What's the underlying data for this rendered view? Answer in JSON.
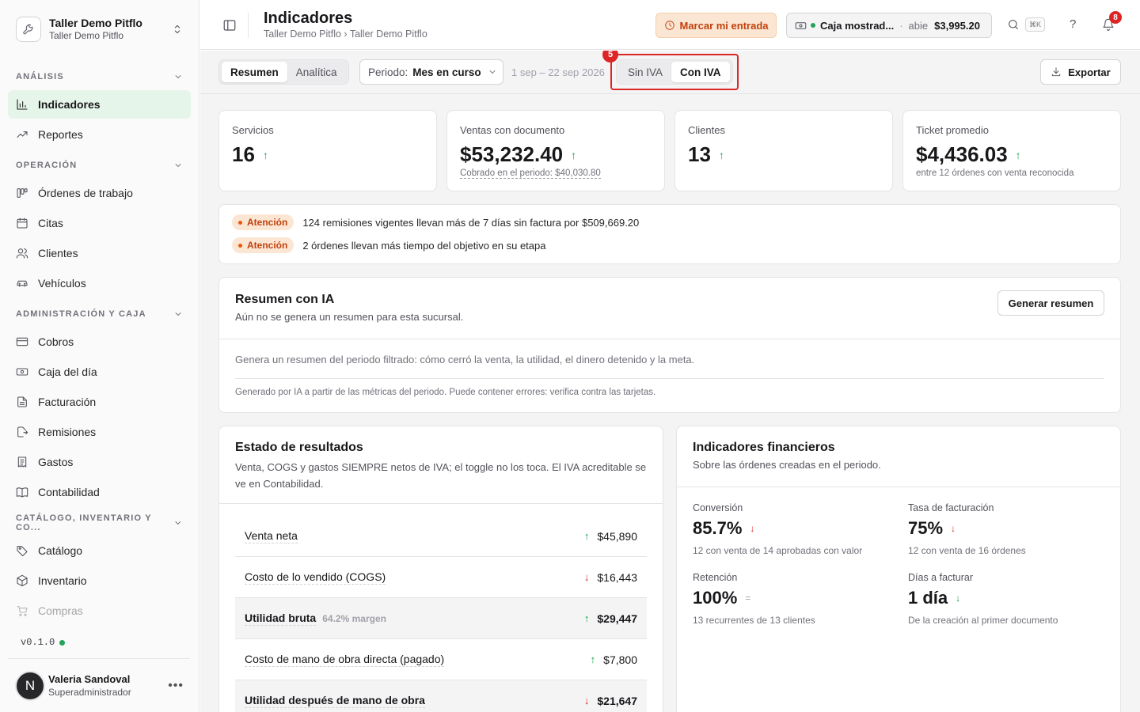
{
  "org": {
    "name": "Taller Demo Pitflo",
    "sub": "Taller Demo Pitflo"
  },
  "sidebar": {
    "sections": [
      {
        "label": "ANÁLISIS",
        "items": [
          {
            "label": "Indicadores",
            "icon": "bar-chart-icon",
            "active": true
          },
          {
            "label": "Reportes",
            "icon": "trend-line-icon"
          }
        ]
      },
      {
        "label": "OPERACIÓN",
        "items": [
          {
            "label": "Órdenes de trabajo",
            "icon": "kanban-icon"
          },
          {
            "label": "Citas",
            "icon": "calendar-icon"
          },
          {
            "label": "Clientes",
            "icon": "users-icon"
          },
          {
            "label": "Vehículos",
            "icon": "car-icon"
          }
        ]
      },
      {
        "label": "ADMINISTRACIÓN Y CAJA",
        "items": [
          {
            "label": "Cobros",
            "icon": "credit-card-icon"
          },
          {
            "label": "Caja del día",
            "icon": "cash-icon"
          },
          {
            "label": "Facturación",
            "icon": "file-icon"
          },
          {
            "label": "Remisiones",
            "icon": "file-export-icon"
          },
          {
            "label": "Gastos",
            "icon": "receipt-icon"
          },
          {
            "label": "Contabilidad",
            "icon": "book-icon"
          }
        ]
      },
      {
        "label": "CATÁLOGO, INVENTARIO Y CO...",
        "items": [
          {
            "label": "Catálogo",
            "icon": "tag-icon"
          },
          {
            "label": "Inventario",
            "icon": "box-icon"
          },
          {
            "label": "Compras",
            "icon": "cart-icon"
          }
        ]
      }
    ]
  },
  "version": "v0.1.0",
  "user": {
    "initial": "N",
    "name": "Valeria Sandoval",
    "role": "Superadministrador"
  },
  "header": {
    "title": "Indicadores",
    "breadcrumb": "Taller Demo Pitflo › Taller Demo Pitflo",
    "entry_button": "Marcar mi entrada",
    "caja_name": "Caja mostrad...",
    "caja_state": "abie",
    "caja_amount": "$3,995.20",
    "kbd": "⌘K",
    "help": "?",
    "notifications": "8"
  },
  "toolbar": {
    "tabs": [
      "Resumen",
      "Analítica"
    ],
    "period_label": "Periodo:",
    "period_value": "Mes en curso",
    "range": "1 sep – 22 sep 2026",
    "iva_toggle": [
      "Sin IVA",
      "Con IVA"
    ],
    "highlight_badge": "5",
    "export": "Exportar"
  },
  "kpis": [
    {
      "label": "Servicios",
      "value": "16",
      "trend": "up",
      "sub": ""
    },
    {
      "label": "Ventas con documento",
      "value": "$53,232.40",
      "trend": "up",
      "sub": "Cobrado en el periodo: $40,030.80"
    },
    {
      "label": "Clientes",
      "value": "13",
      "trend": "up",
      "sub": ""
    },
    {
      "label": "Ticket promedio",
      "value": "$4,436.03",
      "trend": "up",
      "sub": "entre 12 órdenes con venta reconocida"
    }
  ],
  "alerts": [
    {
      "tag": "Atención",
      "text": "124 remisiones vigentes llevan más de 7 días sin factura por $509,669.20"
    },
    {
      "tag": "Atención",
      "text": "2 órdenes llevan más tiempo del objetivo en su etapa"
    }
  ],
  "ia": {
    "title": "Resumen con IA",
    "sub": "Aún no se genera un resumen para esta sucursal.",
    "button": "Generar resumen",
    "desc": "Genera un resumen del periodo filtrado: cómo cerró la venta, la utilidad, el dinero detenido y la meta.",
    "note": "Generado por IA a partir de las métricas del periodo. Puede contener errores: verifica contra las tarjetas."
  },
  "estado": {
    "title": "Estado de resultados",
    "sub": "Venta, COGS y gastos SIEMPRE netos de IVA; el toggle no los toca. El IVA acreditable se ve en Contabilidad.",
    "rows": [
      {
        "label": "Venta neta",
        "sub": "",
        "trend": "up",
        "amount": "$45,890",
        "bold": false
      },
      {
        "label": "Costo de lo vendido (COGS)",
        "sub": "",
        "trend": "down",
        "amount": "$16,443",
        "bold": false
      },
      {
        "label": "Utilidad bruta",
        "sub": "64.2% margen",
        "trend": "up",
        "amount": "$29,447",
        "bold": true
      },
      {
        "label": "Costo de mano de obra directa (pagado)",
        "sub": "",
        "trend": "up",
        "amount": "$7,800",
        "bold": false
      },
      {
        "label": "Utilidad después de mano de obra",
        "sub": "",
        "trend": "down",
        "amount": "$21,647",
        "bold": true
      }
    ]
  },
  "financieros": {
    "title": "Indicadores financieros",
    "sub": "Sobre las órdenes creadas en el periodo.",
    "metrics": [
      {
        "label": "Conversión",
        "value": "85.7%",
        "trend": "down",
        "sub": "12 con venta de 14 aprobadas con valor"
      },
      {
        "label": "Tasa de facturación",
        "value": "75%",
        "trend": "down",
        "sub": "12 con venta de 16 órdenes"
      },
      {
        "label": "Retención",
        "value": "100%",
        "trend": "flat",
        "sub": "13 recurrentes de 13 clientes"
      },
      {
        "label": "Días a facturar",
        "value": "1 día",
        "trend": "down",
        "sub": "De la creación al primer documento"
      }
    ]
  },
  "colors": {
    "accent_green": "#16a34a",
    "alert_red": "#dc2626",
    "warning_orange": "#c2410c",
    "active_nav_bg": "#e6f5ea"
  }
}
